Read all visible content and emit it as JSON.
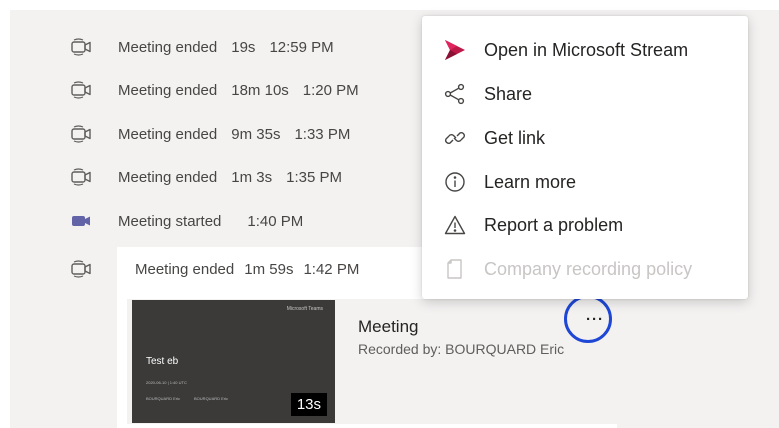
{
  "history": [
    {
      "status": "Meeting ended",
      "duration": "19s",
      "time": "12:59 PM",
      "icon": "video-camera-outline-icon"
    },
    {
      "status": "Meeting ended",
      "duration": "18m 10s",
      "time": "1:20 PM",
      "icon": "video-camera-outline-icon"
    },
    {
      "status": "Meeting ended",
      "duration": "9m 35s",
      "time": "1:33 PM",
      "icon": "video-camera-outline-icon"
    },
    {
      "status": "Meeting ended",
      "duration": "1m 3s",
      "time": "1:35 PM",
      "icon": "video-camera-outline-icon"
    },
    {
      "status": "Meeting started",
      "duration": "",
      "time": "1:40 PM",
      "icon": "video-camera-filled-icon"
    }
  ],
  "last_meeting": {
    "status": "Meeting ended",
    "duration": "1m 59s",
    "time": "1:42 PM"
  },
  "recording": {
    "title": "Meeting",
    "recorded_by": "Recorded by: BOURQUARD Eric",
    "duration_badge": "13s",
    "more_label": "···",
    "thumbnail": {
      "brand": "Microsoft Teams",
      "title": "Test eb",
      "date": "2020-06-10 | 1:40 UTC",
      "person_left": "BOURQUARD Eric",
      "person_right": "BOURQUARD Eric"
    }
  },
  "context_menu": {
    "items": [
      {
        "label": "Open in Microsoft Stream",
        "icon": "stream-icon",
        "enabled": true
      },
      {
        "label": "Share",
        "icon": "share-icon",
        "enabled": true
      },
      {
        "label": "Get link",
        "icon": "link-icon",
        "enabled": true
      },
      {
        "label": "Learn more",
        "icon": "info-icon",
        "enabled": true
      },
      {
        "label": "Report a problem",
        "icon": "warning-icon",
        "enabled": true
      },
      {
        "label": "Company recording policy",
        "icon": "document-icon",
        "enabled": false
      }
    ]
  },
  "colors": {
    "accent": "#6264a7",
    "stream": "#bc1948",
    "highlight_circle": "#1f47d6"
  }
}
